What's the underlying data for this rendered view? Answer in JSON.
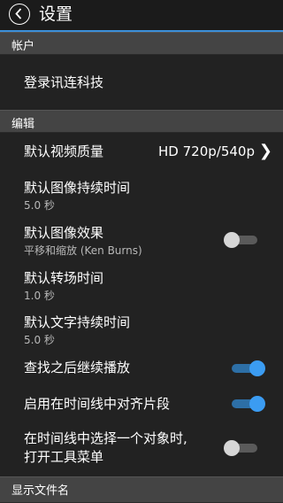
{
  "header": {
    "title": "设置"
  },
  "sections": {
    "account": "帐户",
    "edit": "编辑",
    "display_filename": "显示文件名"
  },
  "account": {
    "login_label": "登录讯连科技"
  },
  "settings": {
    "video_quality": {
      "label": "默认视频质量",
      "value": "HD 720p/540p",
      "chevron": "❯"
    },
    "image_duration": {
      "label": "默认图像持续时间",
      "value": "5.0 秒"
    },
    "image_effect": {
      "label": "默认图像效果",
      "sub": "平移和缩放 (Ken Burns)",
      "toggle": false
    },
    "transition_duration": {
      "label": "默认转场时间",
      "value": "1.0 秒"
    },
    "text_duration": {
      "label": "默认文字持续时间",
      "value": "5.0 秒"
    },
    "continue_playback": {
      "label": "查找之后继续播放",
      "toggle": true
    },
    "snap_to_timeline": {
      "label": "启用在时间线中对齐片段",
      "toggle": true
    },
    "open_toolbox": {
      "label_line1": "在时间线中选择一个对象时,",
      "label_line2": "打开工具菜单",
      "toggle": false
    }
  },
  "colors": {
    "accent": "#3b9cf2",
    "background": "#222222",
    "section": "#444444"
  }
}
